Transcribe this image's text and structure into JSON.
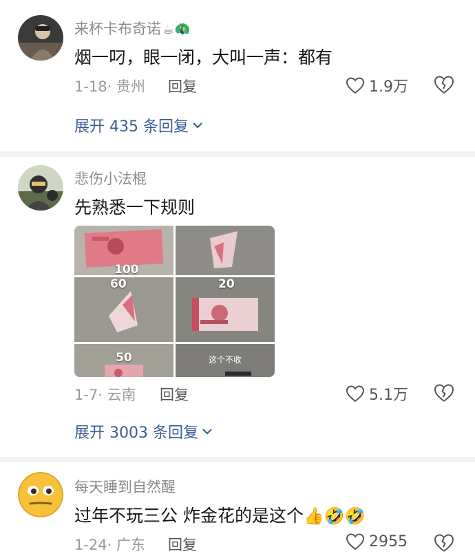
{
  "comments": [
    {
      "username": "来杯卡布奇诺",
      "emojis": "☕🦚",
      "text": "烟一叼，眼一闭，大叫一声：都有",
      "date_location": "1-18· 贵州",
      "reply_label": "回复",
      "likes": "1.9万",
      "expand_label": "展开 435 条回复"
    },
    {
      "username": "悲伤小法棍",
      "text": "先熟悉一下规则",
      "images": [
        "100",
        "60",
        "20",
        "50",
        "这个不收"
      ],
      "date_location": "1-7· 云南",
      "reply_label": "回复",
      "likes": "5.1万",
      "expand_label": "展开 3003 条回复"
    },
    {
      "username": "每天睡到自然醒",
      "text": "过年不玩三公 炸金花的是这个",
      "emojis": "👍🤣🤣",
      "date_location": "1-24· 广东",
      "reply_label": "回复",
      "likes": "2955"
    }
  ],
  "colors": {
    "link": "#3a5b95",
    "meta": "#9a9a9a",
    "divider": "#f3f3f3"
  }
}
